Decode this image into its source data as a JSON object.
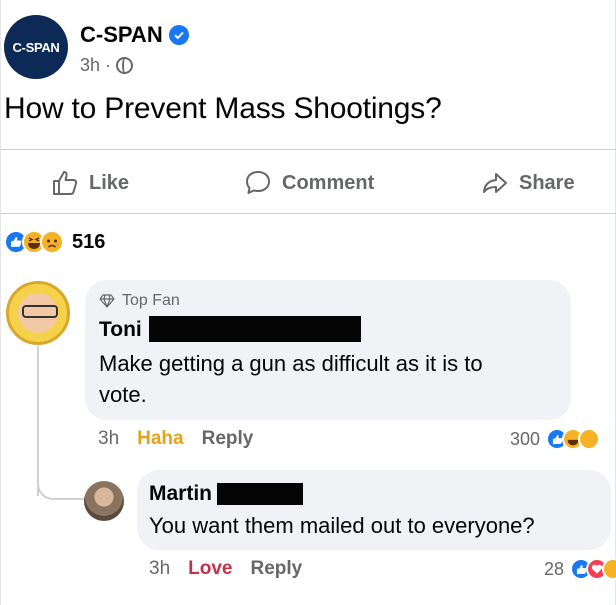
{
  "post": {
    "avatar_text": "C-SPAN",
    "page_name": "C-SPAN",
    "time": "3h",
    "separator": "·",
    "text": "How to Prevent Mass Shootings?"
  },
  "actions": {
    "like": "Like",
    "comment": "Comment",
    "share": "Share"
  },
  "reactions": {
    "count": "516",
    "types": [
      "like",
      "haha",
      "sad"
    ]
  },
  "comments": [
    {
      "badge": "Top Fan",
      "author": "Toni",
      "text_line1": "Make getting a gun as difficult as it is to",
      "text_line2": "vote.",
      "time": "3h",
      "reaction_action": "Haha",
      "reply": "Reply",
      "reaction_count": "300"
    },
    {
      "author": "Martin",
      "text": "You want them mailed out to everyone?",
      "time": "3h",
      "reaction_action": "Love",
      "reply": "Reply",
      "reaction_count": "28"
    }
  ],
  "colors": {
    "facebook_blue": "#1877f2",
    "secondary_text": "#65676b",
    "haha_text": "#e5a21a",
    "love_text": "#c43249",
    "bubble": "#f0f2f5"
  }
}
